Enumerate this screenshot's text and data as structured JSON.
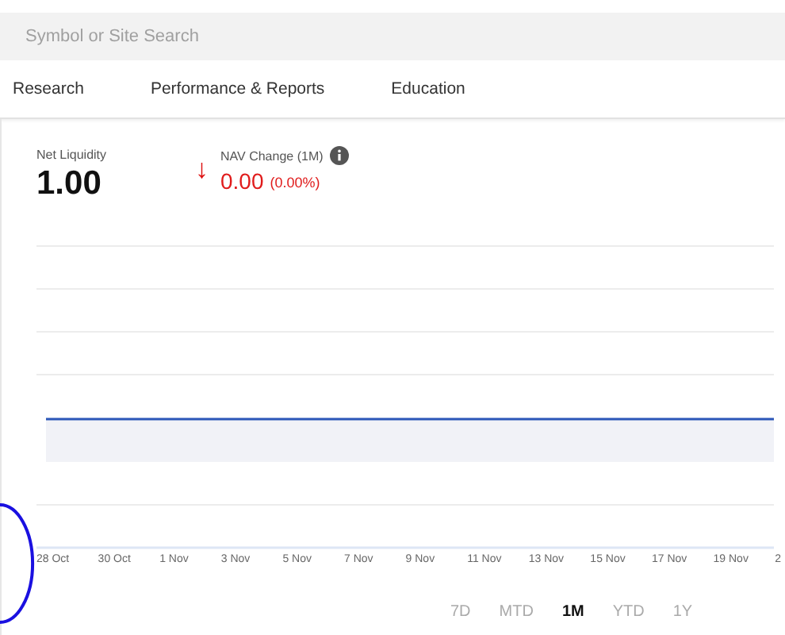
{
  "search": {
    "placeholder": "Symbol or Site Search"
  },
  "nav": {
    "items": [
      {
        "label": "Research"
      },
      {
        "label": "Performance & Reports"
      },
      {
        "label": "Education"
      }
    ]
  },
  "summary": {
    "net_liquidity": {
      "label": "Net Liquidity",
      "value": "1.00"
    },
    "nav_change": {
      "arrow": "↓",
      "label": "NAV Change (1M)",
      "value": "0.00",
      "percent": "(0.00%)"
    }
  },
  "chart": {
    "x_labels": [
      "28 Oct",
      "30 Oct",
      "1 Nov",
      "3 Nov",
      "5 Nov",
      "7 Nov",
      "9 Nov",
      "11 Nov",
      "13 Nov",
      "15 Nov",
      "17 Nov",
      "19 Nov",
      "2"
    ]
  },
  "ranges": [
    {
      "label": "7D",
      "selected": false
    },
    {
      "label": "MTD",
      "selected": false
    },
    {
      "label": "1M",
      "selected": true
    },
    {
      "label": "YTD",
      "selected": false
    },
    {
      "label": "1Y",
      "selected": false
    }
  ]
}
